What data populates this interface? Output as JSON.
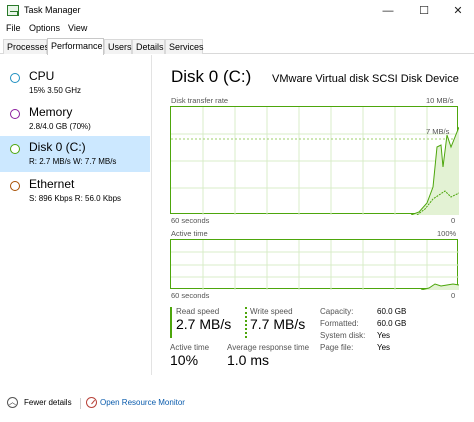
{
  "window": {
    "title": "Task Manager",
    "minimize_glyph": "—",
    "maximize_glyph": "☐",
    "close_glyph": "✕"
  },
  "menu": {
    "file": "File",
    "options": "Options",
    "view": "View"
  },
  "tabs": [
    {
      "label": "Processes"
    },
    {
      "label": "Performance"
    },
    {
      "label": "Users"
    },
    {
      "label": "Details"
    },
    {
      "label": "Services"
    }
  ],
  "sidebar": {
    "items": [
      {
        "title": "CPU",
        "subtitle": "15%  3.50 GHz",
        "color": "#1f8fc1"
      },
      {
        "title": "Memory",
        "subtitle": "2.8/4.0 GB (70%)",
        "color": "#8b1d9e"
      },
      {
        "title": "Disk 0 (C:)",
        "subtitle": "R: 2.7 MB/s  W: 7.7 MB/s",
        "color": "#4da60c"
      },
      {
        "title": "Ethernet",
        "subtitle": "S: 896 Kbps  R: 56.0 Kbps",
        "color": "#a74f01"
      }
    ]
  },
  "main": {
    "title": "Disk 0 (C:)",
    "device": "VMware Virtual disk SCSI Disk Device",
    "graph1": {
      "label": "Disk transfer rate",
      "max": "10 MB/s",
      "marker": "7 MB/s",
      "time": "60 seconds",
      "min": "0"
    },
    "graph2": {
      "label": "Active time",
      "max": "100%",
      "time": "60 seconds",
      "min": "0"
    },
    "read_speed_label": "Read speed",
    "read_speed": "2.7 MB/s",
    "write_speed_label": "Write speed",
    "write_speed": "7.7 MB/s",
    "active_time_label": "Active time",
    "active_time": "10%",
    "avg_response_label": "Average response time",
    "avg_response": "1.0 ms",
    "properties": [
      {
        "key": "Capacity:",
        "value": "60.0 GB"
      },
      {
        "key": "Formatted:",
        "value": "60.0 GB"
      },
      {
        "key": "System disk:",
        "value": "Yes"
      },
      {
        "key": "Page file:",
        "value": "Yes"
      }
    ],
    "accent_color": "#4da60c"
  },
  "footer": {
    "fewer_details": "Fewer details",
    "resource_monitor": "Open Resource Monitor"
  }
}
